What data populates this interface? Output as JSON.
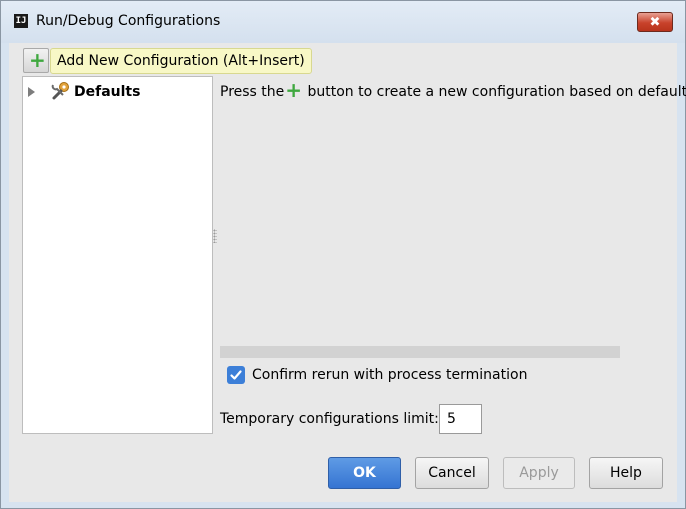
{
  "window": {
    "title": "Run/Debug Configurations",
    "app_icon_text": "IJ",
    "close_symbol": "✖"
  },
  "toolbar": {
    "add_symbol": "+",
    "add_tooltip": "Add New Configuration (Alt+Insert)"
  },
  "tree": {
    "items": [
      {
        "label": "Defaults",
        "icon": "wrench-gear-icon",
        "expanded": false
      }
    ]
  },
  "main": {
    "hint_before": "Press the",
    "hint_symbol": "+",
    "hint_after": " button to create a new configuration based on default"
  },
  "options": {
    "confirm_rerun_label": "Confirm rerun with process termination",
    "confirm_rerun_checked": true,
    "temp_limit_label": "Temporary configurations limit:",
    "temp_limit_value": "5"
  },
  "buttons": {
    "ok": "OK",
    "cancel": "Cancel",
    "apply": "Apply",
    "help": "Help"
  },
  "colors": {
    "accent_blue": "#3574d2",
    "plus_green": "#3fa83f",
    "tooltip_bg": "#f8f8c6",
    "close_red": "#c8422b"
  }
}
